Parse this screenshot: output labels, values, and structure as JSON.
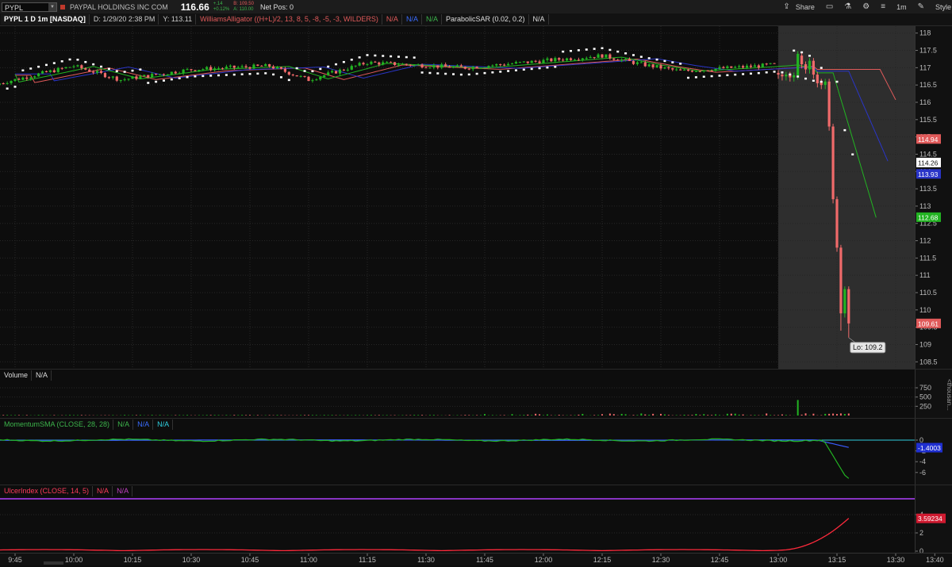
{
  "toolbar": {
    "symbol": "PYPL",
    "company": "PAYPAL HOLDINGS INC COM",
    "last": "116.66",
    "change": "+.14",
    "change_pct": "+0.12%",
    "bid": "B: 109.50",
    "ask": "A: 110.00",
    "net_pos": "Net Pos: 0",
    "share": "Share",
    "timeframe": "1m",
    "style": "Style",
    "icons": [
      "share-icon",
      "window-icon",
      "flask-icon",
      "gear-icon",
      "menu-icon"
    ]
  },
  "price_header": {
    "title": "PYPL 1 D 1m [NASDAQ]",
    "date": "D: 1/29/20 2:38 PM",
    "y": "Y: 113.11",
    "alligator": "WilliamsAlligator ((H+L)/2, 13, 8, 5, -8, -5, -3, WILDERS)",
    "alli_na1": "N/A",
    "alli_na2": "N/A",
    "alli_na3": "N/A",
    "sar": "ParabolicSAR (0.02, 0.2)",
    "sar_na": "N/A"
  },
  "price_axis": {
    "ticks": [
      "118",
      "117.5",
      "117",
      "116.5",
      "116",
      "115.5",
      "115",
      "114.5",
      "114",
      "113.5",
      "113",
      "112.5",
      "112",
      "111.5",
      "111",
      "110.5",
      "110",
      "109.5",
      "109",
      "108.5"
    ],
    "tags": [
      {
        "label": "114.94",
        "value": 114.94,
        "color": "#e05a5a"
      },
      {
        "label": "114.26",
        "value": 114.26,
        "color": "#ffffff"
      },
      {
        "label": "113.93",
        "value": 113.93,
        "color": "#2a35c8"
      },
      {
        "label": "112.68",
        "value": 112.68,
        "color": "#22b322"
      },
      {
        "label": "109.61",
        "value": 109.61,
        "color": "#e05a5a"
      }
    ],
    "lo_label": "Lo: 109.2"
  },
  "volume": {
    "title": "Volume",
    "na": "N/A",
    "ticks": [
      "750",
      "500",
      "250"
    ],
    "unit": "<thousan..."
  },
  "momentum": {
    "title": "MomentumSMA (CLOSE, 28, 28)",
    "na1": "N/A",
    "na2": "N/A",
    "na3": "N/A",
    "ticks": [
      "0",
      "-2",
      "-4",
      "-6"
    ],
    "tag": "-1.4003"
  },
  "ulcer": {
    "title": "UlcerIndex (CLOSE, 14, 5)",
    "na1": "N/A",
    "na2": "N/A",
    "ticks": [
      "4",
      "2",
      "0"
    ],
    "tag": "3.59234"
  },
  "time_axis": {
    "labels": [
      "9:45",
      "10:00",
      "10:15",
      "10:30",
      "10:45",
      "11:00",
      "11:15",
      "11:30",
      "11:45",
      "12:00",
      "12:15",
      "12:30",
      "12:45",
      "13:00",
      "13:15",
      "13:30",
      "13:40"
    ]
  },
  "colors": {
    "up": "#22b322",
    "down": "#f06a6a",
    "sar": "#ffffff",
    "jaw": "#2a35c8",
    "teeth": "#e05a5a",
    "lips": "#22b322",
    "momentum": "#22b322",
    "mom_avg": "#3a5cff",
    "ulcer": "#ff2a3c",
    "ulcer_ref": "#b040ff"
  },
  "chart_data": {
    "type": "candlestick",
    "ylim": [
      108.3,
      118.2
    ],
    "sessions": [
      {
        "close_path": "pre-13:00 range 116.5–117.5, post-13:00 drop to 109.61",
        "low": 109.2
      }
    ]
  }
}
